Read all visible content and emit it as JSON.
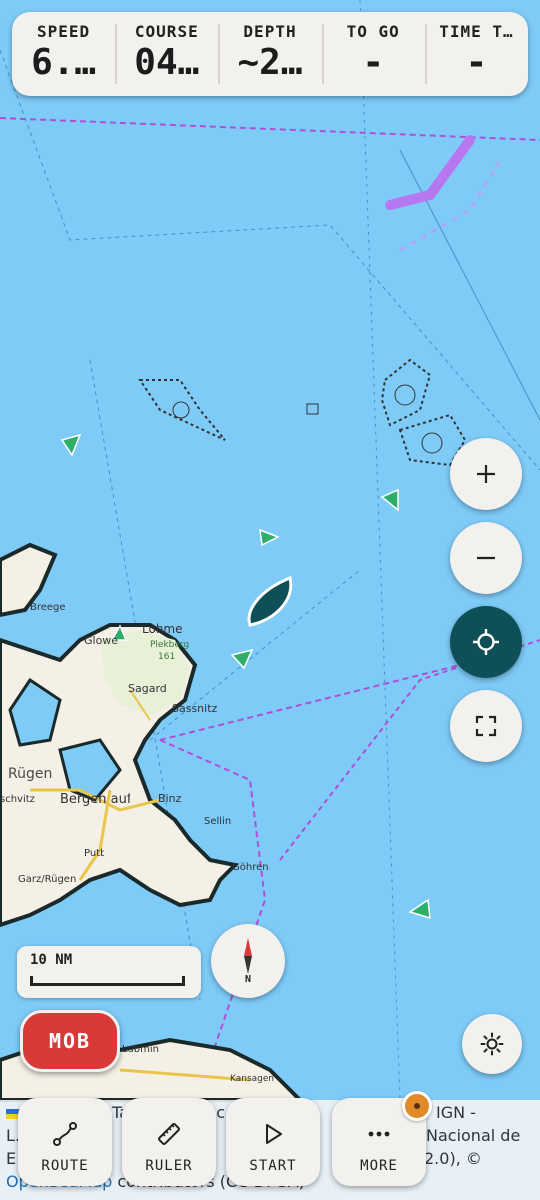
{
  "dashboard": {
    "metrics": [
      {
        "label": "SPEED",
        "value": "6.…"
      },
      {
        "label": "COURSE",
        "value": "04…"
      },
      {
        "label": "DEPTH",
        "value": "~2…"
      },
      {
        "label": "TO GO",
        "value": "-"
      },
      {
        "label": "TIME T…",
        "value": "-"
      }
    ]
  },
  "map": {
    "places": [
      "Lohme",
      "Plekberg",
      "161",
      "Glowe",
      "Sagard",
      "Sassnitz",
      "Rügen",
      "Bergen auf Rügen",
      "Binz",
      "Sellin",
      "Göhren",
      "Garz/Rügen",
      "Putbus",
      "Breege",
      "schvitz",
      "Lubmin",
      "Kansagen"
    ],
    "colors": {
      "water": "#7ecbf8",
      "land": "#f4f0e6",
      "boat": "#0f4f57",
      "route": "#b04fd6"
    }
  },
  "controls": {
    "zoom_in": "plus-icon",
    "zoom_out": "minus-icon",
    "locate": "crosshair-icon",
    "fullscreen": "fullscreen-icon",
    "light": "sun-icon"
  },
  "scale": {
    "label": "10 NM"
  },
  "compass": {
    "label": "N"
  },
  "mob": {
    "label": "MOB"
  },
  "attribution": {
    "line1_pre": "",
    "line1_mid": "Tan… un… ll-c…",
    "line1_post": "IGN -",
    "line2_pre": "L…",
    "line2_post": "Nacional de",
    "line3_pre": "E…",
    "line3_post": "2.0), ©",
    "link": "OpenSeaMap",
    "line4_post": "contributors (CC-BY-SA)"
  },
  "nav": [
    {
      "label": "ROUTE",
      "icon": "route-icon"
    },
    {
      "label": "RULER",
      "icon": "ruler-icon"
    },
    {
      "label": "START",
      "icon": "play-icon"
    },
    {
      "label": "MORE",
      "icon": "more-icon"
    }
  ]
}
